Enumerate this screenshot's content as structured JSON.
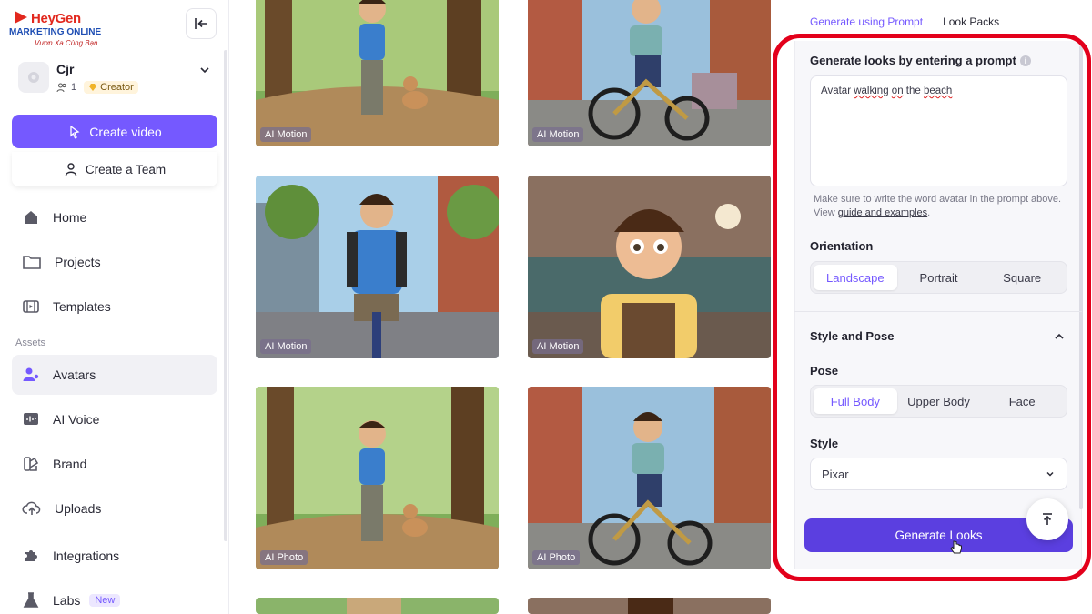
{
  "logo": {
    "brand": "HeyGen",
    "line1": "MARKETING ONLINE",
    "line2": "Vươn Xa Cùng Bạn"
  },
  "account": {
    "name": "Cjr",
    "members": "1",
    "plan": "Creator"
  },
  "actions": {
    "create_video": "Create video",
    "create_team": "Create a Team"
  },
  "nav": {
    "home": "Home",
    "projects": "Projects",
    "templates": "Templates",
    "assets_label": "Assets",
    "avatars": "Avatars",
    "ai_voice": "AI Voice",
    "brand": "Brand",
    "uploads": "Uploads",
    "integrations": "Integrations",
    "labs": "Labs",
    "labs_badge": "New"
  },
  "grid": {
    "cards": [
      {
        "tag": "AI Motion"
      },
      {
        "tag": "AI Motion"
      },
      {
        "tag": "AI Motion"
      },
      {
        "tag": "AI Motion"
      },
      {
        "tag": "AI Photo"
      },
      {
        "tag": "AI Photo"
      }
    ]
  },
  "panel": {
    "tab_active": "Generate using Prompt",
    "tab_other": "Look Packs",
    "prompt_title": "Generate looks by entering a prompt",
    "prompt_value_pre": "Avatar ",
    "prompt_value_w1": "walking",
    "prompt_value_mid": " ",
    "prompt_value_w2": "on",
    "prompt_value_mid2": " the ",
    "prompt_value_w3": "beach",
    "helper_text": "Make sure to write the word avatar in the prompt above. View ",
    "helper_link": "guide and examples",
    "helper_end": ".",
    "orientation_title": "Orientation",
    "orientation_options": [
      "Landscape",
      "Portrait",
      "Square"
    ],
    "orientation_selected": "Landscape",
    "style_pose_title": "Style and Pose",
    "pose_title": "Pose",
    "pose_options": [
      "Full Body",
      "Upper Body",
      "Face"
    ],
    "pose_selected": "Full Body",
    "style_title": "Style",
    "style_value": "Pixar",
    "generate_button": "Generate Looks"
  },
  "colors": {
    "accent": "#7559ff",
    "generate": "#5b3fe0",
    "highlight_frame": "#e3001b"
  }
}
